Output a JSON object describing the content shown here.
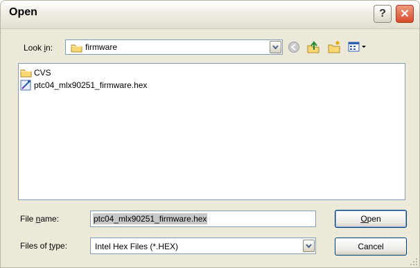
{
  "window": {
    "title": "Open",
    "help_label": "?",
    "close_label": "✕"
  },
  "look_in": {
    "label_pre": "Look ",
    "label_mnemonic": "i",
    "label_post": "n:",
    "value": "firmware"
  },
  "files": [
    {
      "name": "CVS",
      "icon": "folder-icon"
    },
    {
      "name": "ptc04_mlx90251_firmware.hex",
      "icon": "hex-file-icon"
    }
  ],
  "file_name": {
    "label_pre": "File ",
    "label_mnemonic": "n",
    "label_post": "ame:",
    "value": "ptc04_mlx90251_firmware.hex"
  },
  "file_type": {
    "label_pre": "Files of ",
    "label_mnemonic": "t",
    "label_post": "ype:",
    "value": "Intel Hex Files (*.HEX)"
  },
  "buttons": {
    "open_mnemonic": "O",
    "open_rest": "pen",
    "cancel": "Cancel"
  },
  "colors": {
    "accent_border": "#7F9DB9",
    "window_bg": "#ECE9D8",
    "close_red": "#D84A2A"
  }
}
